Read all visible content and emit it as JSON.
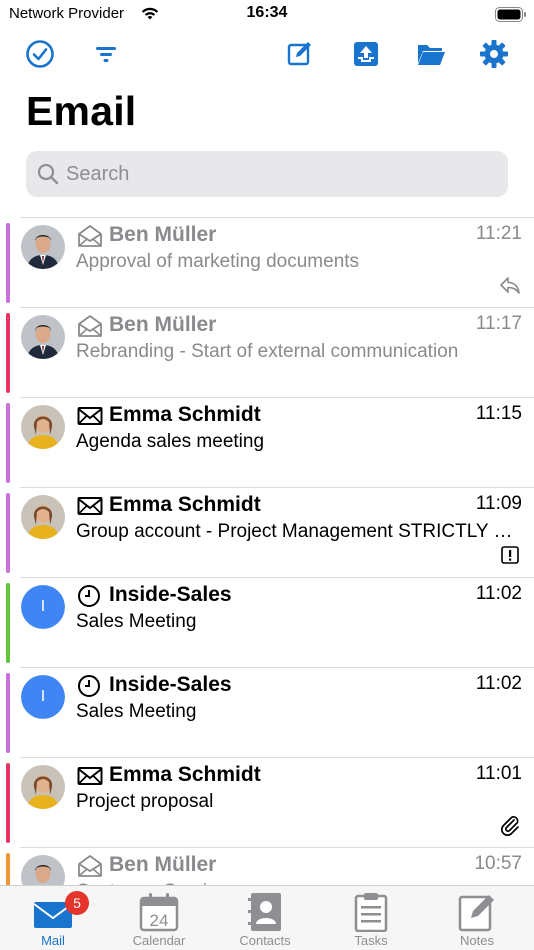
{
  "status_bar": {
    "carrier": "Network Provider",
    "time": "16:34"
  },
  "toolbar": {
    "icons": [
      "check-circle-icon",
      "filter-icon",
      "compose-icon",
      "inbox-upload-icon",
      "folder-icon",
      "gear-icon"
    ],
    "accent": "#1874cd"
  },
  "header": {
    "title": "Email"
  },
  "search": {
    "placeholder": "Search",
    "value": ""
  },
  "messages": [
    {
      "sender": "Ben Müller",
      "subject": "Approval of marketing documents",
      "time": "11:21",
      "read": true,
      "type_icon": "envelope-open-icon",
      "avatar": "photo-man",
      "color": "#c96fd9",
      "badge": "reply-icon"
    },
    {
      "sender": "Ben Müller",
      "subject": "Rebranding - Start of external communication",
      "time": "11:17",
      "read": true,
      "type_icon": "envelope-open-icon",
      "avatar": "photo-man",
      "color": "#e8345e",
      "badge": ""
    },
    {
      "sender": "Emma Schmidt",
      "subject": "Agenda sales meeting",
      "time": "11:15",
      "read": false,
      "type_icon": "envelope-icon",
      "avatar": "photo-woman",
      "color": "#c96fd9",
      "badge": ""
    },
    {
      "sender": "Emma Schmidt",
      "subject": "Group account - Project Management  STRICTLY CONFIDENTIAL",
      "time": "11:09",
      "read": false,
      "type_icon": "envelope-icon",
      "avatar": "photo-woman",
      "color": "#c96fd9",
      "badge": "important-icon"
    },
    {
      "sender": "Inside-Sales",
      "subject": "Sales Meeting",
      "time": "11:02",
      "read": false,
      "type_icon": "clock-icon",
      "avatar": "I",
      "color": "#5ec73a",
      "badge": ""
    },
    {
      "sender": "Inside-Sales",
      "subject": "Sales Meeting",
      "time": "11:02",
      "read": false,
      "type_icon": "clock-icon",
      "avatar": "I",
      "color": "#c96fd9",
      "badge": ""
    },
    {
      "sender": "Emma Schmidt",
      "subject": "Project proposal",
      "time": "11:01",
      "read": false,
      "type_icon": "envelope-icon",
      "avatar": "photo-woman",
      "color": "#e8345e",
      "badge": "paperclip-icon"
    },
    {
      "sender": "Ben Müller",
      "subject": "Customer Service",
      "time": "10:57",
      "read": true,
      "type_icon": "envelope-open-icon",
      "avatar": "photo-man",
      "color": "#f0962e",
      "badge": ""
    }
  ],
  "tabs": [
    {
      "label": "Mail",
      "icon": "mail-icon",
      "badge": "5",
      "active": true
    },
    {
      "label": "Calendar",
      "icon": "calendar-icon",
      "badge": "",
      "active": false,
      "calendar_day": "24"
    },
    {
      "label": "Contacts",
      "icon": "contacts-icon",
      "badge": "",
      "active": false
    },
    {
      "label": "Tasks",
      "icon": "tasks-icon",
      "badge": "",
      "active": false
    },
    {
      "label": "Notes",
      "icon": "notes-icon",
      "badge": "",
      "active": false
    }
  ]
}
